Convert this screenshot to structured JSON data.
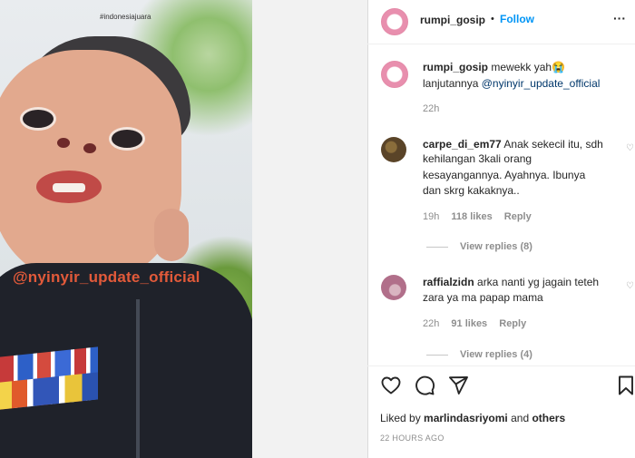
{
  "header": {
    "username": "rumpi_gosip",
    "dot": "•",
    "follow_label": "Follow",
    "more": "···"
  },
  "caption": {
    "username": "rumpi_gosip",
    "text": "mewekk yah😭",
    "line2": "lanjutannya",
    "mention": "@nyinyir_update_official",
    "time": "22h"
  },
  "comments": [
    {
      "username": "carpe_di_em77",
      "text_line1": "Anak sekecil itu, sdh",
      "text_rest": [
        "kehilangan 3kali orang",
        "kesayangannya. Ayahnya. Ibunya",
        "dan skrg kakaknya.."
      ],
      "time": "19h",
      "likes": "118 likes",
      "reply": "Reply",
      "view_replies": "View replies (8)"
    },
    {
      "username": "raffialzidn",
      "text_line1": "arka nanti yg jagain teteh",
      "text_rest": [
        "zara ya ma papap mama"
      ],
      "time": "22h",
      "likes": "91 likes",
      "reply": "Reply",
      "view_replies": "View replies (4)"
    }
  ],
  "footer": {
    "liked_prefix": "Liked by",
    "liked_user": "marlindasriyomi",
    "liked_and": "and",
    "liked_others": "others",
    "timestamp": "22 HOURS AGO"
  },
  "photo": {
    "watermark_top": "#indonesiajuara",
    "watermark_mid": "@nyinyir_update_official"
  },
  "icons": [
    "heart-icon",
    "comment-icon",
    "share-icon",
    "bookmark-icon"
  ]
}
